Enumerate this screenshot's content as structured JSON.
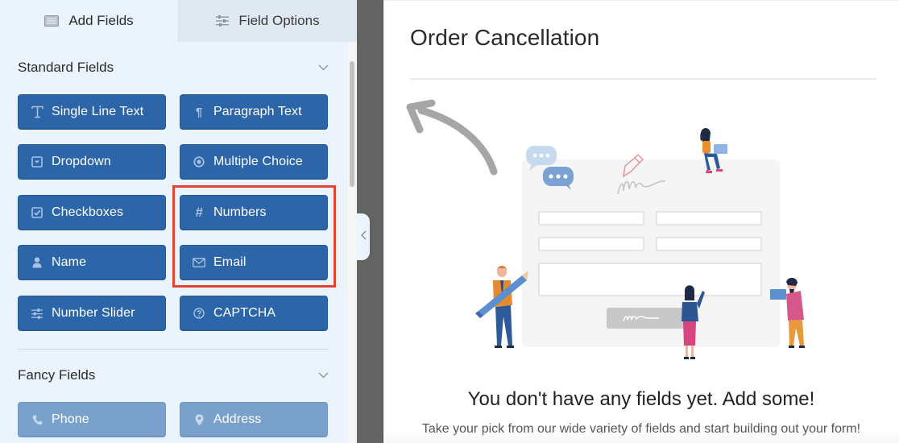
{
  "sidebar": {
    "tabs": [
      {
        "label": "Add Fields",
        "icon": "list-icon",
        "active": true
      },
      {
        "label": "Field Options",
        "icon": "sliders-icon",
        "active": false
      }
    ],
    "sections": [
      {
        "title": "Standard Fields",
        "expanded": true,
        "fields": [
          {
            "label": "Single Line Text",
            "icon": "text-cursor-icon"
          },
          {
            "label": "Paragraph Text",
            "icon": "pilcrow-icon"
          },
          {
            "label": "Dropdown",
            "icon": "dropdown-icon"
          },
          {
            "label": "Multiple Choice",
            "icon": "radio-icon"
          },
          {
            "label": "Checkboxes",
            "icon": "checkbox-icon"
          },
          {
            "label": "Numbers",
            "icon": "hash-icon"
          },
          {
            "label": "Name",
            "icon": "user-icon"
          },
          {
            "label": "Email",
            "icon": "envelope-icon"
          },
          {
            "label": "Number Slider",
            "icon": "sliders-icon"
          },
          {
            "label": "CAPTCHA",
            "icon": "question-circle-icon"
          }
        ]
      },
      {
        "title": "Fancy Fields",
        "expanded": true,
        "fields": [
          {
            "label": "Phone",
            "icon": "phone-icon"
          },
          {
            "label": "Address",
            "icon": "map-pin-icon"
          }
        ]
      }
    ],
    "highlighted_fields": [
      "Numbers",
      "Email"
    ]
  },
  "preview": {
    "form_title": "Order Cancellation",
    "empty_title": "You don't have any fields yet. Add some!",
    "empty_subtitle": "Take your pick from our wide variety of fields and start building out your form!"
  },
  "colors": {
    "button_blue": "#2d66a8",
    "button_faded": "#7aa0cc",
    "sidebar_bg": "#ebf3fc",
    "highlight_red": "#e2452f",
    "gutter_gray": "#636363"
  }
}
